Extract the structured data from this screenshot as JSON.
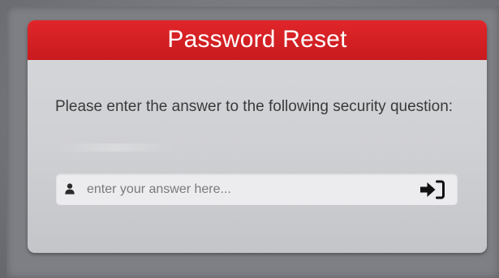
{
  "dialog": {
    "title": "Password Reset",
    "instruction": "Please enter the answer to the following security question:"
  },
  "answer_field": {
    "placeholder": "enter your answer here...",
    "value": "",
    "icon": "user-icon"
  },
  "submit": {
    "icon": "sign-in-icon"
  },
  "colors": {
    "header": "#d4201f",
    "card": "#d1d2d5",
    "background": "#717278"
  }
}
